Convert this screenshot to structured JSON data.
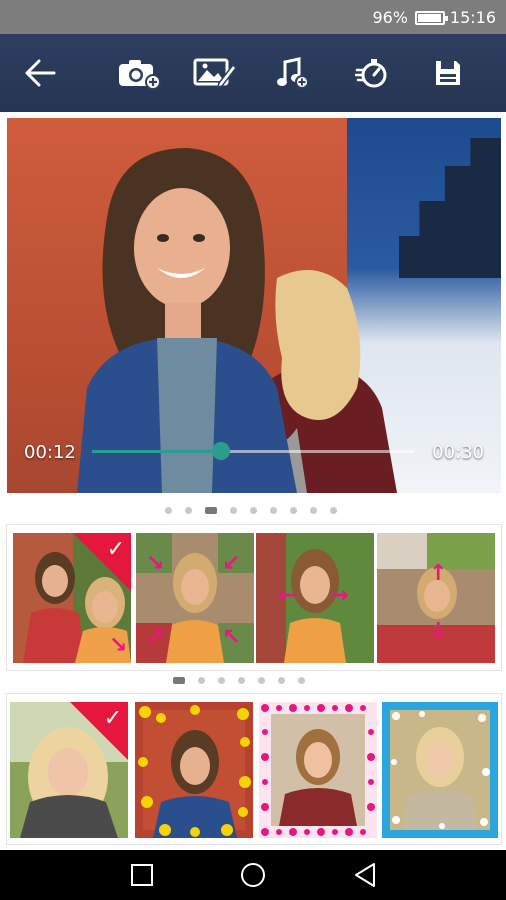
{
  "status_bar": {
    "battery_percent": "96%",
    "time": "15:16",
    "icons": [
      "battery-icon"
    ]
  },
  "toolbar": {
    "buttons": [
      {
        "name": "back",
        "icon": "arrow-left-icon"
      },
      {
        "name": "add-camera",
        "icon": "camera-plus-icon"
      },
      {
        "name": "edit-image",
        "icon": "image-edit-icon"
      },
      {
        "name": "add-music",
        "icon": "music-plus-icon"
      },
      {
        "name": "duration",
        "icon": "stopwatch-icon"
      },
      {
        "name": "save",
        "icon": "save-icon"
      }
    ]
  },
  "preview": {
    "current_time": "00:12",
    "total_time": "00:30",
    "progress": 0.4
  },
  "transitions_strip": {
    "page_count": 9,
    "active_page": 2,
    "items": [
      {
        "selected": true,
        "effect": "slide-bottom-right"
      },
      {
        "selected": false,
        "effect": "zoom-corners-out"
      },
      {
        "selected": false,
        "effect": "push-horizontal"
      },
      {
        "selected": false,
        "effect": "push-vertical"
      }
    ]
  },
  "frames_strip": {
    "page_count": 7,
    "active_page": 0,
    "items": [
      {
        "selected": true,
        "frame": "none"
      },
      {
        "selected": false,
        "frame": "yellow-flowers"
      },
      {
        "selected": false,
        "frame": "pink-hearts"
      },
      {
        "selected": false,
        "frame": "blue-snow"
      }
    ]
  },
  "colors": {
    "toolbar": "#2e3f60",
    "accent_teal": "#2a9d8f",
    "selection_red": "#e5173f",
    "arrow_pink": "#e6177f"
  },
  "navbar": {
    "buttons": [
      "recent-apps-icon",
      "home-icon",
      "back-icon"
    ]
  }
}
